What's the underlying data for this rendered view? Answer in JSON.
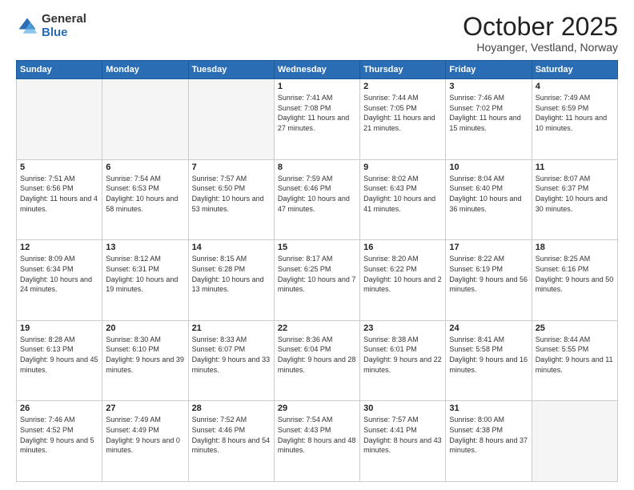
{
  "logo": {
    "general": "General",
    "blue": "Blue"
  },
  "header": {
    "month": "October 2025",
    "location": "Hoyanger, Vestland, Norway"
  },
  "weekdays": [
    "Sunday",
    "Monday",
    "Tuesday",
    "Wednesday",
    "Thursday",
    "Friday",
    "Saturday"
  ],
  "weeks": [
    [
      {
        "day": "",
        "sunrise": "",
        "sunset": "",
        "daylight": "",
        "empty": true
      },
      {
        "day": "",
        "sunrise": "",
        "sunset": "",
        "daylight": "",
        "empty": true
      },
      {
        "day": "",
        "sunrise": "",
        "sunset": "",
        "daylight": "",
        "empty": true
      },
      {
        "day": "1",
        "sunrise": "Sunrise: 7:41 AM",
        "sunset": "Sunset: 7:08 PM",
        "daylight": "Daylight: 11 hours and 27 minutes."
      },
      {
        "day": "2",
        "sunrise": "Sunrise: 7:44 AM",
        "sunset": "Sunset: 7:05 PM",
        "daylight": "Daylight: 11 hours and 21 minutes."
      },
      {
        "day": "3",
        "sunrise": "Sunrise: 7:46 AM",
        "sunset": "Sunset: 7:02 PM",
        "daylight": "Daylight: 11 hours and 15 minutes."
      },
      {
        "day": "4",
        "sunrise": "Sunrise: 7:49 AM",
        "sunset": "Sunset: 6:59 PM",
        "daylight": "Daylight: 11 hours and 10 minutes."
      }
    ],
    [
      {
        "day": "5",
        "sunrise": "Sunrise: 7:51 AM",
        "sunset": "Sunset: 6:56 PM",
        "daylight": "Daylight: 11 hours and 4 minutes."
      },
      {
        "day": "6",
        "sunrise": "Sunrise: 7:54 AM",
        "sunset": "Sunset: 6:53 PM",
        "daylight": "Daylight: 10 hours and 58 minutes."
      },
      {
        "day": "7",
        "sunrise": "Sunrise: 7:57 AM",
        "sunset": "Sunset: 6:50 PM",
        "daylight": "Daylight: 10 hours and 53 minutes."
      },
      {
        "day": "8",
        "sunrise": "Sunrise: 7:59 AM",
        "sunset": "Sunset: 6:46 PM",
        "daylight": "Daylight: 10 hours and 47 minutes."
      },
      {
        "day": "9",
        "sunrise": "Sunrise: 8:02 AM",
        "sunset": "Sunset: 6:43 PM",
        "daylight": "Daylight: 10 hours and 41 minutes."
      },
      {
        "day": "10",
        "sunrise": "Sunrise: 8:04 AM",
        "sunset": "Sunset: 6:40 PM",
        "daylight": "Daylight: 10 hours and 36 minutes."
      },
      {
        "day": "11",
        "sunrise": "Sunrise: 8:07 AM",
        "sunset": "Sunset: 6:37 PM",
        "daylight": "Daylight: 10 hours and 30 minutes."
      }
    ],
    [
      {
        "day": "12",
        "sunrise": "Sunrise: 8:09 AM",
        "sunset": "Sunset: 6:34 PM",
        "daylight": "Daylight: 10 hours and 24 minutes."
      },
      {
        "day": "13",
        "sunrise": "Sunrise: 8:12 AM",
        "sunset": "Sunset: 6:31 PM",
        "daylight": "Daylight: 10 hours and 19 minutes."
      },
      {
        "day": "14",
        "sunrise": "Sunrise: 8:15 AM",
        "sunset": "Sunset: 6:28 PM",
        "daylight": "Daylight: 10 hours and 13 minutes."
      },
      {
        "day": "15",
        "sunrise": "Sunrise: 8:17 AM",
        "sunset": "Sunset: 6:25 PM",
        "daylight": "Daylight: 10 hours and 7 minutes."
      },
      {
        "day": "16",
        "sunrise": "Sunrise: 8:20 AM",
        "sunset": "Sunset: 6:22 PM",
        "daylight": "Daylight: 10 hours and 2 minutes."
      },
      {
        "day": "17",
        "sunrise": "Sunrise: 8:22 AM",
        "sunset": "Sunset: 6:19 PM",
        "daylight": "Daylight: 9 hours and 56 minutes."
      },
      {
        "day": "18",
        "sunrise": "Sunrise: 8:25 AM",
        "sunset": "Sunset: 6:16 PM",
        "daylight": "Daylight: 9 hours and 50 minutes."
      }
    ],
    [
      {
        "day": "19",
        "sunrise": "Sunrise: 8:28 AM",
        "sunset": "Sunset: 6:13 PM",
        "daylight": "Daylight: 9 hours and 45 minutes."
      },
      {
        "day": "20",
        "sunrise": "Sunrise: 8:30 AM",
        "sunset": "Sunset: 6:10 PM",
        "daylight": "Daylight: 9 hours and 39 minutes."
      },
      {
        "day": "21",
        "sunrise": "Sunrise: 8:33 AM",
        "sunset": "Sunset: 6:07 PM",
        "daylight": "Daylight: 9 hours and 33 minutes."
      },
      {
        "day": "22",
        "sunrise": "Sunrise: 8:36 AM",
        "sunset": "Sunset: 6:04 PM",
        "daylight": "Daylight: 9 hours and 28 minutes."
      },
      {
        "day": "23",
        "sunrise": "Sunrise: 8:38 AM",
        "sunset": "Sunset: 6:01 PM",
        "daylight": "Daylight: 9 hours and 22 minutes."
      },
      {
        "day": "24",
        "sunrise": "Sunrise: 8:41 AM",
        "sunset": "Sunset: 5:58 PM",
        "daylight": "Daylight: 9 hours and 16 minutes."
      },
      {
        "day": "25",
        "sunrise": "Sunrise: 8:44 AM",
        "sunset": "Sunset: 5:55 PM",
        "daylight": "Daylight: 9 hours and 11 minutes."
      }
    ],
    [
      {
        "day": "26",
        "sunrise": "Sunrise: 7:46 AM",
        "sunset": "Sunset: 4:52 PM",
        "daylight": "Daylight: 9 hours and 5 minutes."
      },
      {
        "day": "27",
        "sunrise": "Sunrise: 7:49 AM",
        "sunset": "Sunset: 4:49 PM",
        "daylight": "Daylight: 9 hours and 0 minutes."
      },
      {
        "day": "28",
        "sunrise": "Sunrise: 7:52 AM",
        "sunset": "Sunset: 4:46 PM",
        "daylight": "Daylight: 8 hours and 54 minutes."
      },
      {
        "day": "29",
        "sunrise": "Sunrise: 7:54 AM",
        "sunset": "Sunset: 4:43 PM",
        "daylight": "Daylight: 8 hours and 48 minutes."
      },
      {
        "day": "30",
        "sunrise": "Sunrise: 7:57 AM",
        "sunset": "Sunset: 4:41 PM",
        "daylight": "Daylight: 8 hours and 43 minutes."
      },
      {
        "day": "31",
        "sunrise": "Sunrise: 8:00 AM",
        "sunset": "Sunset: 4:38 PM",
        "daylight": "Daylight: 8 hours and 37 minutes."
      },
      {
        "day": "",
        "sunrise": "",
        "sunset": "",
        "daylight": "",
        "empty": true
      }
    ]
  ]
}
